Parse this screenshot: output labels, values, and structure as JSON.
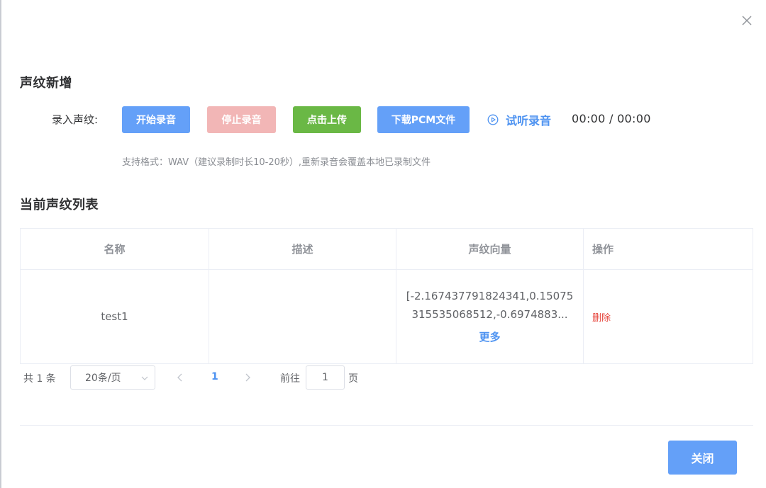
{
  "dialog": {
    "close_icon": "close-icon"
  },
  "add_section": {
    "title": "声纹新增",
    "record_label": "录入声纹:",
    "buttons": {
      "start": "开始录音",
      "stop": "停止录音",
      "upload": "点击上传",
      "download": "下载PCM文件"
    },
    "play_label": "试听录音",
    "play_icon": "play-circle-icon",
    "time": "00:00 / 00:00",
    "hint": "支持格式：WAV（建议录制时长10-20秒）,重新录音会覆盖本地已录制文件",
    "colors": {
      "primary": "#64a0f8",
      "danger_disabled": "#f2b6b6",
      "success": "#6ab845",
      "link": "#4e93f1"
    }
  },
  "list_section": {
    "title": "当前声纹列表",
    "columns": [
      "名称",
      "描述",
      "声纹向量",
      "操作"
    ],
    "rows": [
      {
        "name": "test1",
        "description": "",
        "vector_line1": "[-2.167437791824341,0.15075",
        "vector_line2": "315535068512,-0.6974883...",
        "more": "更多",
        "delete": "删除"
      }
    ],
    "delete_color": "#e6433a"
  },
  "pagination": {
    "total": "共 1 条",
    "page_size": "20条/页",
    "current_page": "1",
    "goto_label": "前往",
    "goto_value": "1",
    "page_suffix": "页"
  },
  "footer": {
    "close_label": "关闭"
  }
}
